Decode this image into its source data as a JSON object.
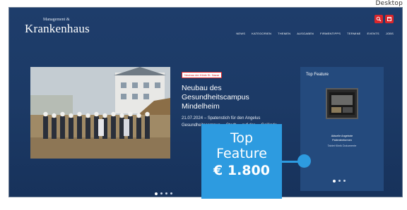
{
  "device_label": "Desktop",
  "site": {
    "logo_top": "Management &",
    "logo_main": "Krankenhaus"
  },
  "header_icons": [
    {
      "name": "search-icon",
      "color": "#d9262b"
    },
    {
      "name": "menu-icon",
      "color": "#d9262b"
    }
  ],
  "nav": [
    "NEWS",
    "KATEGORIEN",
    "THEMEN",
    "AUSGABEN",
    "FIRMENTIPPS",
    "TERMINE",
    "EVENTS",
    "JOBS"
  ],
  "slide": {
    "badge": "Neubau der Klinik St. Nazar",
    "title": "Neubau des Gesundheitscampus Mindelheim",
    "body": "21.07.2024 – Spatenstich für den Angelus Gesundheitscampus ... Stadt ... auf der ... Gelände ..."
  },
  "slider_dots": 4,
  "top_feature": {
    "title": "Top Feature",
    "caption_1": "Aktuelle Angebote",
    "caption_2": "Patientenformen",
    "caption_3": "Tablet Klinik Dokumente"
  },
  "feature_dots": 3,
  "price_badge": {
    "line1": "Top",
    "line2": "Feature",
    "price": "€ 1.800",
    "color": "#2d9be0"
  },
  "colors": {
    "background": "#1e3d6b",
    "accent_red": "#d9262b",
    "accent_blue": "#2d9be0"
  }
}
